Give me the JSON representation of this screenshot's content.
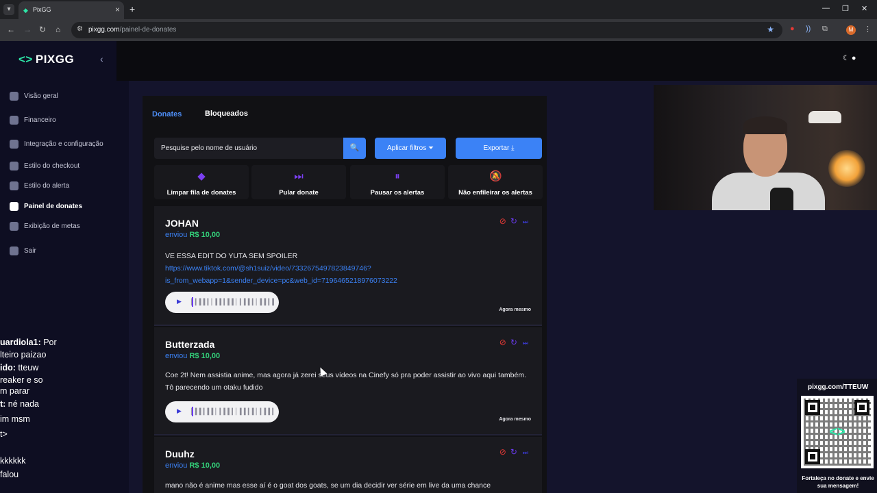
{
  "browser": {
    "tab_title": "PixGG",
    "url_host": "pixgg.com",
    "url_path": "/painel-de-donates",
    "profile_initial": "M"
  },
  "sidebar": {
    "logo": "PIXGG",
    "items": [
      {
        "label": "Visão geral"
      },
      {
        "label": "Financeiro"
      },
      {
        "label": "Integração e configuração"
      },
      {
        "label": "Estilo do checkout"
      },
      {
        "label": "Estilo do alerta"
      },
      {
        "label": "Painel de donates"
      },
      {
        "label": "Exibição de metas"
      },
      {
        "label": "Sair"
      }
    ]
  },
  "chat": [
    {
      "user": "uardiola1:",
      "text": " Por"
    },
    {
      "user": "",
      "text": "lteiro paizao"
    },
    {
      "user": "ido:",
      "text": " tteuw"
    },
    {
      "user": "",
      "text": "reaker e so"
    },
    {
      "user": "",
      "text": "m parar"
    },
    {
      "user": "t:",
      "text": " né nada"
    },
    {
      "user": "",
      "text": "im msm"
    },
    {
      "user": "",
      "text": "t>"
    },
    {
      "user": "",
      "text": "kkkkkk"
    },
    {
      "user": "",
      "text": "falou"
    }
  ],
  "tabs": {
    "donates": "Donates",
    "blocked": "Bloqueados"
  },
  "search": {
    "placeholder": "Pesquise pelo nome de usuário"
  },
  "buttons": {
    "filters": "Aplicar filtros",
    "export": "Exportar"
  },
  "actions": [
    {
      "label": "Limpar fila de donates",
      "icon": "eraser-icon"
    },
    {
      "label": "Pular donate",
      "icon": "skip-icon"
    },
    {
      "label": "Pausar os alertas",
      "icon": "pause-icon"
    },
    {
      "label": "Não enfileirar os alertas",
      "icon": "bell-off-icon"
    }
  ],
  "donations": [
    {
      "name": "JOHAN",
      "sent": "enviou",
      "amount": "R$ 10,00",
      "message": "VE ESSA EDIT DO YUTA SEM SPOILER",
      "link": "https://www.tiktok.com/@sh1suiz/video/7332675497823849746?is_from_webapp=1&sender_device=pc&web_id=7196465218976073222",
      "time": "Agora mesmo"
    },
    {
      "name": "Butterzada",
      "sent": "enviou",
      "amount": "R$ 10,00",
      "message": "Coe 2t! Nem assistia anime, mas agora já zerei seus vídeos na Cinefy só pra poder assistir ao vivo aqui também. Tô parecendo um otaku fudido",
      "link": "",
      "time": "Agora mesmo"
    },
    {
      "name": "Duuhz",
      "sent": "enviou",
      "amount": "R$ 10,00",
      "message": "mano não é anime mas esse aí é o goat dos goats, se um dia decidir ver série em live da uma chance",
      "link": "",
      "time": ""
    }
  ],
  "qr": {
    "url": "pixgg.com/TTEUW",
    "caption": "Fortaleça no donate e envie sua mensagem!"
  },
  "colors": {
    "accent": "#3b82f6",
    "amount": "#33d17a",
    "brand": "#2ee6a8",
    "danger": "#e53935"
  }
}
